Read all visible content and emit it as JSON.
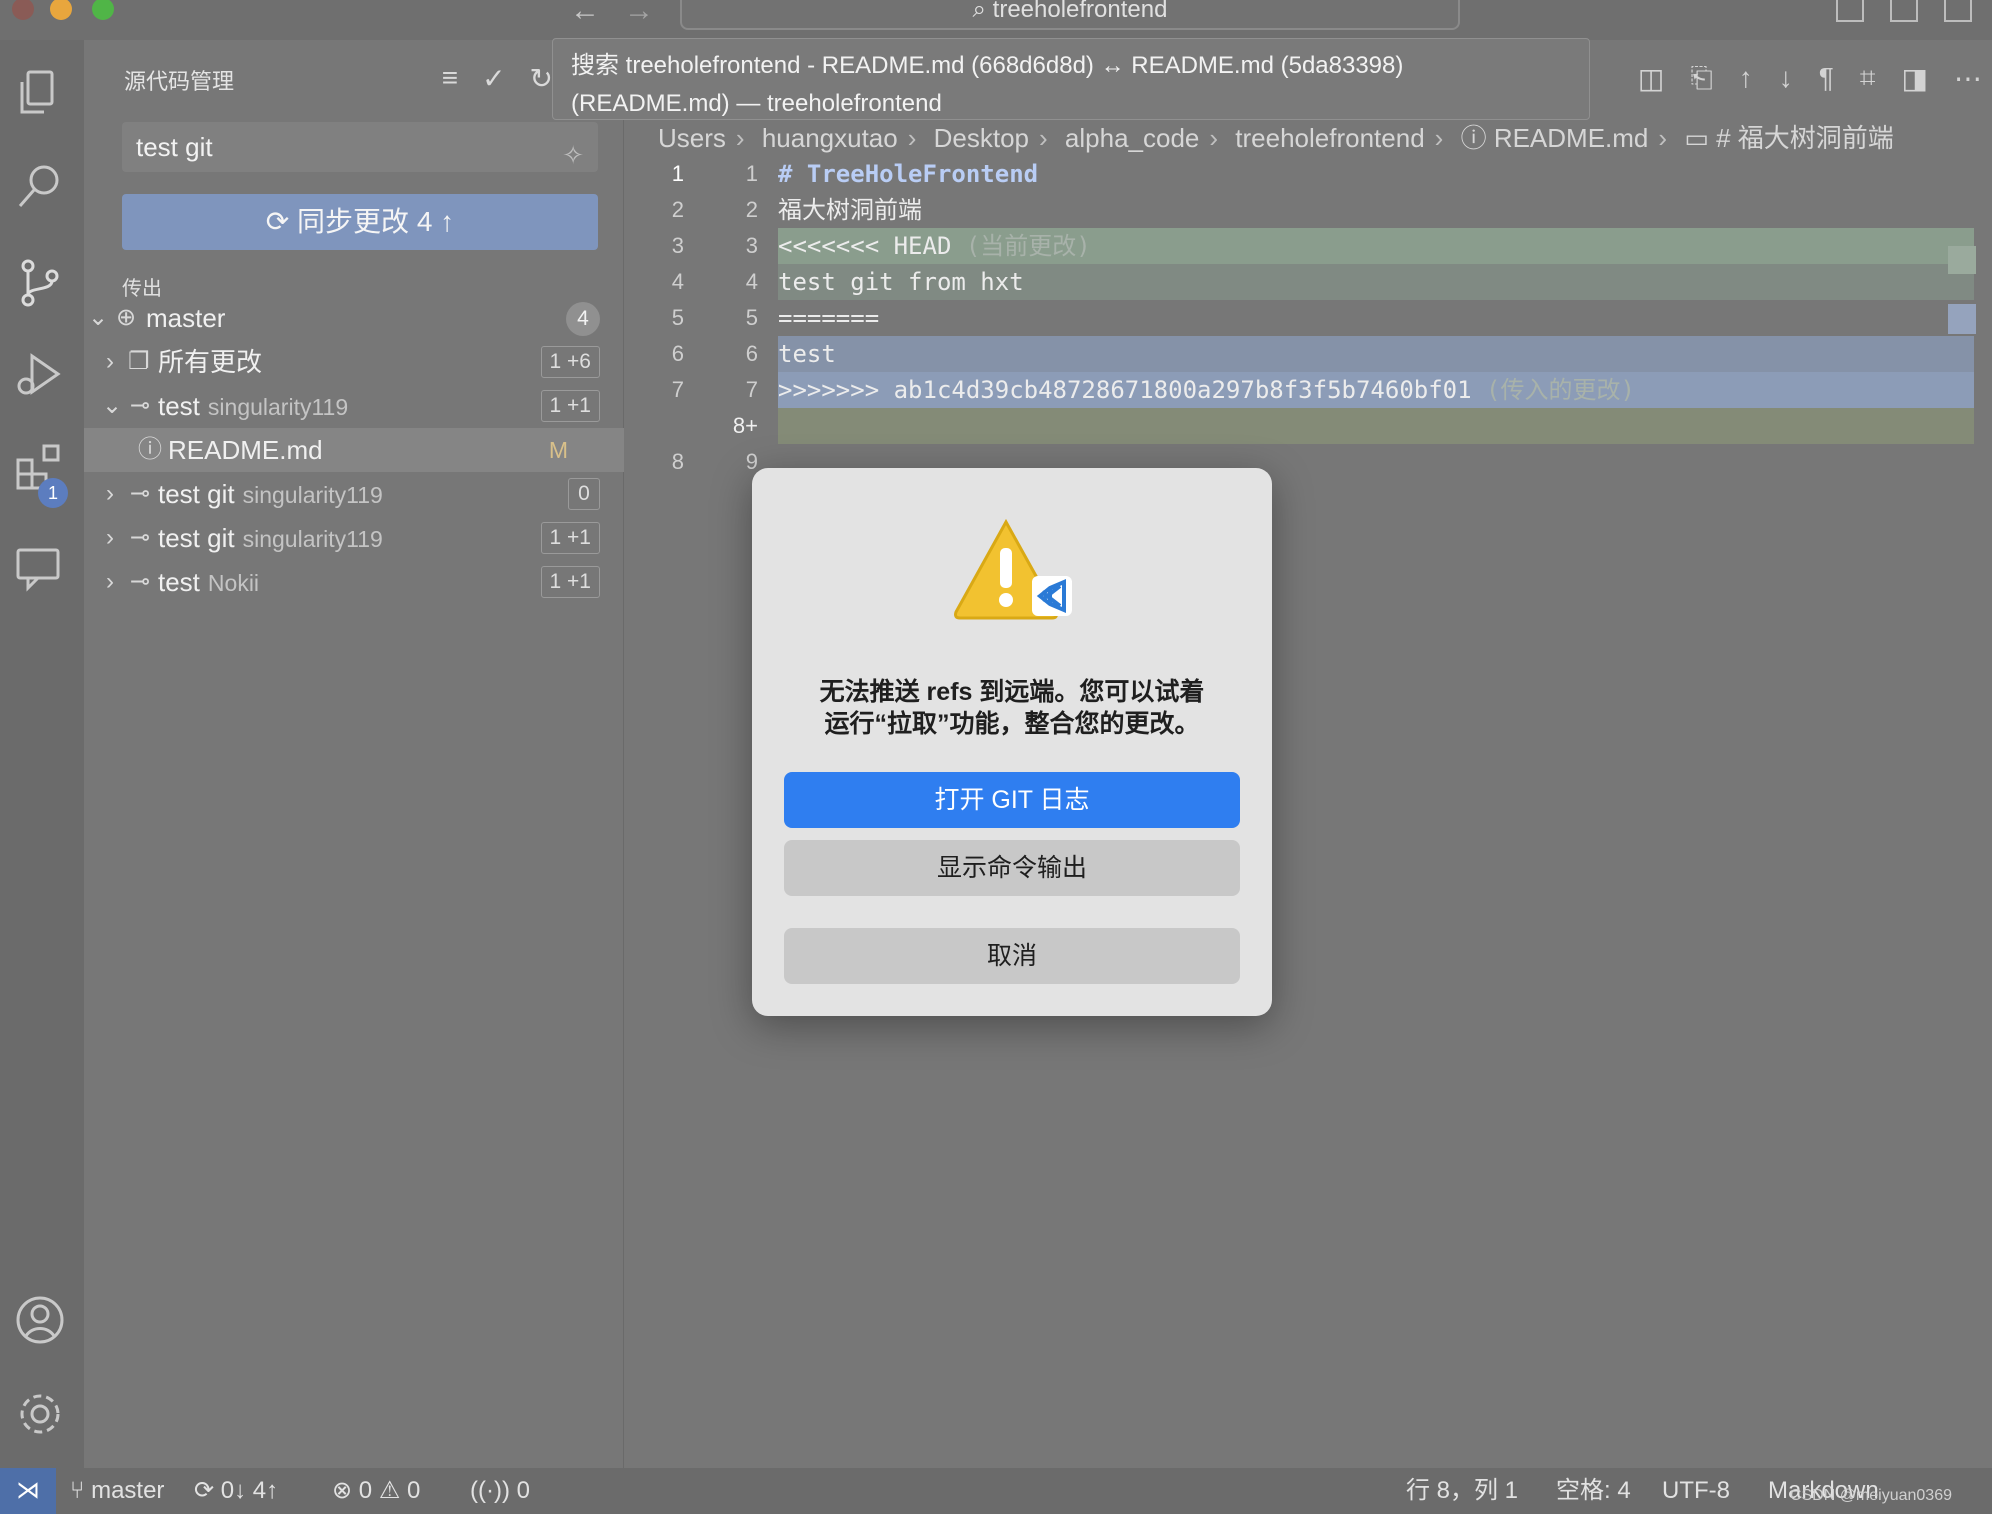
{
  "window": {
    "title": "treeholefrontend"
  },
  "sidebar": {
    "title": "源代码管理",
    "commit_input_value": "test git",
    "sync_button_label": "同步更改 4",
    "section_label": "传出",
    "branch": {
      "label": "master",
      "count": "4"
    },
    "all_changes": {
      "label": "所有更改",
      "count": "1 +6"
    },
    "commits": [
      {
        "message": "test",
        "author": "singularity119",
        "count": "1 +1"
      },
      {
        "message": "test git",
        "author": "singularity119",
        "count": "0"
      },
      {
        "message": "test git",
        "author": "singularity119",
        "count": "1 +1"
      },
      {
        "message": "test",
        "author": "Nokii",
        "count": "1 +1"
      }
    ],
    "file": {
      "name": "README.md",
      "status": "M"
    }
  },
  "activity": {
    "extensions_badge": "1"
  },
  "hover_tooltip": {
    "line1": "搜索 treeholefrontend - README.md (668d6d8d) ↔ README.md (5da83398)",
    "line2": "(README.md) — treeholefrontend"
  },
  "breadcrumbs": [
    "Users",
    "huangxutao",
    "Desktop",
    "alpha_code",
    "treeholefrontend",
    "README.md",
    "# 福大树洞前端"
  ],
  "editor": {
    "lines": [
      {
        "left": "1",
        "right": "1",
        "text": "# TreeHoleFrontend"
      },
      {
        "left": "2",
        "right": "2",
        "text": "福大树洞前端"
      },
      {
        "left": "3",
        "right": "3",
        "text": "<<<<<<< HEAD",
        "note": "(当前更改)"
      },
      {
        "left": "4",
        "right": "4",
        "text": "test git from hxt"
      },
      {
        "left": "5",
        "right": "5",
        "text": "======="
      },
      {
        "left": "6",
        "right": "6",
        "text": "test"
      },
      {
        "left": "7",
        "right": "7",
        "text": ">>>>>>> ab1c4d39cb48728671800a297b8f3f5b7460bf01",
        "note": "(传入的更改)"
      },
      {
        "left": "",
        "right": "8+",
        "text": ""
      },
      {
        "left": "8",
        "right": "9",
        "text": ""
      }
    ]
  },
  "dialog": {
    "message_line1": "无法推送 refs 到远端。您可以试着",
    "message_line2": "运行“拉取”功能，整合您的更改。",
    "primary_button": "打开 GIT 日志",
    "secondary_button": "显示命令输出",
    "cancel_button": "取消"
  },
  "statusbar": {
    "branch": "master",
    "sync": "0↓ 4↑",
    "errors": "0",
    "warnings": "0",
    "ports": "0",
    "position": "行 8，列 1",
    "spaces": "空格: 4",
    "encoding": "UTF-8",
    "language": "Markdown",
    "watermark": "CSDN @meiyuan0369"
  },
  "colors": {
    "accent": "#2f7ef0",
    "sync_button": "#7f95bd",
    "current_change": "#8a9d8d",
    "incoming_change": "#8c9cb7"
  }
}
